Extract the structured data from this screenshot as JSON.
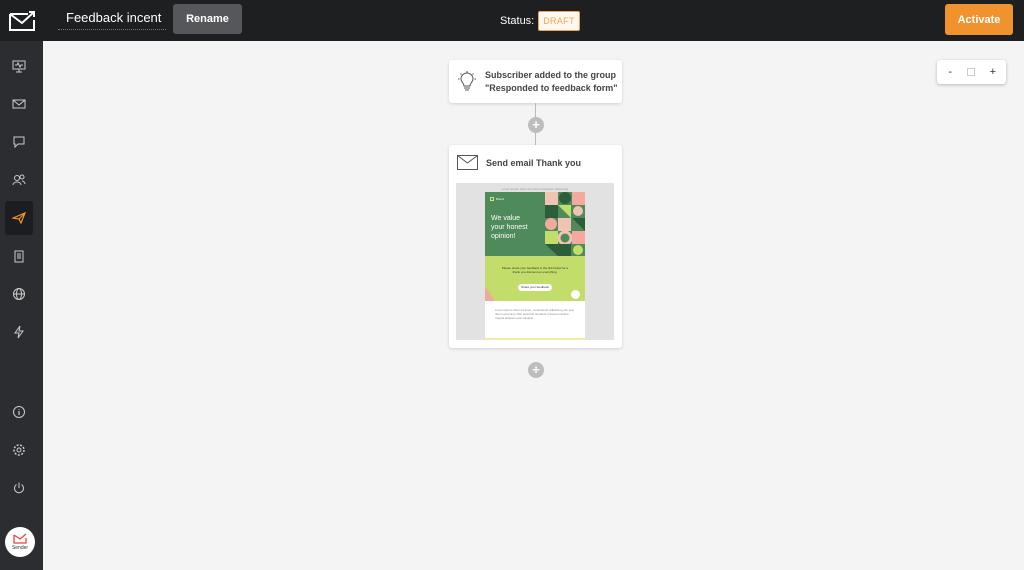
{
  "header": {
    "campaign_name": "Feedback incent",
    "rename_label": "Rename",
    "status_label": "Status:",
    "status_value": "DRAFT",
    "activate_label": "Activate"
  },
  "colors": {
    "accent": "#f0932f",
    "status_draft": "#f0a25c",
    "topbar": "#1e1f21",
    "sidebar": "#2b2d31"
  },
  "sidebar": {
    "items": [
      {
        "icon": "monitor-icon"
      },
      {
        "icon": "envelope-icon"
      },
      {
        "icon": "chat-icon"
      },
      {
        "icon": "users-icon"
      },
      {
        "icon": "paper-plane-icon",
        "active": true
      },
      {
        "icon": "clipboard-icon"
      },
      {
        "icon": "globe-icon"
      },
      {
        "icon": "lightning-icon"
      },
      {
        "icon": "info-icon"
      },
      {
        "icon": "gear-icon"
      },
      {
        "icon": "power-icon"
      }
    ],
    "account_label": "Sender"
  },
  "zoom": {
    "minus": "-",
    "plus": "+"
  },
  "workflow": {
    "trigger": {
      "line1": "Subscriber added to the group",
      "line2": "\"Responded to feedback form\""
    },
    "add_step": "+",
    "email_step": {
      "title": "Send email Thank you",
      "preview": {
        "top_text": "Lorem ipsum dolor sit amet consectetur adipiscing",
        "brand": "Brand",
        "hero_line1": "We value",
        "hero_line2": "your honest",
        "hero_line3": "opinion!",
        "lime_text": "Please share your feedback in the link below for a thank you discount on everything.",
        "button": "Share your feedback",
        "body_text": "Lorem ipsum dolor sit amet, consectetur adipiscing elit, sed diam nonummy nibh euismod tincidunt ut laoreet dolore magna aliquam erat volutpat."
      }
    }
  }
}
